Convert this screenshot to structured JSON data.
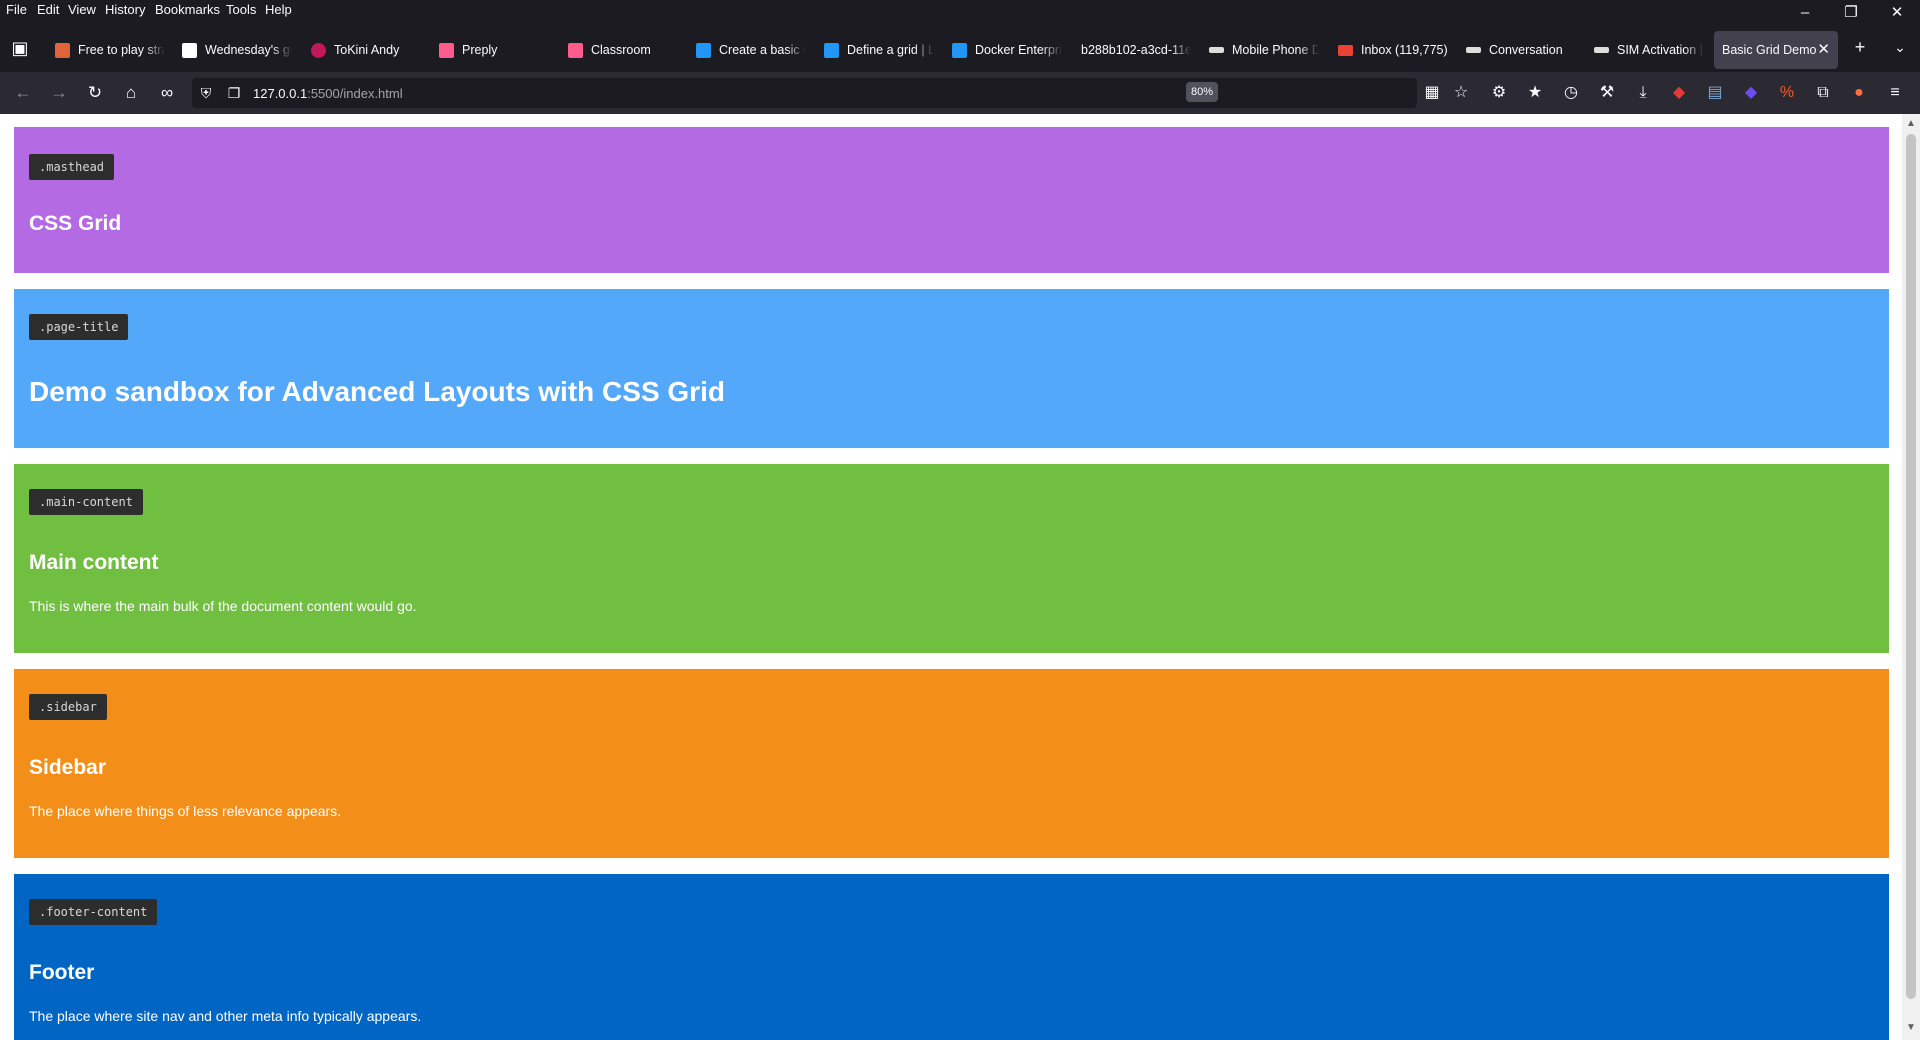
{
  "menubar": {
    "items": [
      "File",
      "Edit",
      "View",
      "History",
      "Bookmarks",
      "Tools",
      "Help"
    ]
  },
  "tabs": [
    {
      "label": "Free to play stra",
      "favicon_color": "#e0643a"
    },
    {
      "label": "Wednesday's gc",
      "favicon_color": "#ffffff"
    },
    {
      "label": "ToKini Andy",
      "favicon_color": "#c2185b"
    },
    {
      "label": "Preply",
      "favicon_color": "#ff5c8d"
    },
    {
      "label": "Classroom",
      "favicon_color": "#ff5c8d"
    },
    {
      "label": "Create a basic G",
      "favicon_color": "#2196f3"
    },
    {
      "label": "Define a grid | L",
      "favicon_color": "#2196f3"
    },
    {
      "label": "Docker Enterpri",
      "favicon_color": "#2196f3"
    },
    {
      "label": "b288b102-a3cd-11e",
      "favicon_color": ""
    },
    {
      "label": "Mobile Phone D",
      "favicon_color": "#dddddd"
    },
    {
      "label": "Inbox (119,775)",
      "favicon_color": "#ea4335"
    },
    {
      "label": "Conversation",
      "favicon_color": "#dddddd"
    },
    {
      "label": "SIM Activation |",
      "favicon_color": "#dddddd"
    }
  ],
  "active_tab": {
    "label": "Basic Grid Demo",
    "close": "✕"
  },
  "urlbar": {
    "host": "127.0.0.1",
    "rest": ":5500/index.html",
    "zoom": "80%"
  },
  "page": {
    "sections": [
      {
        "tag": ".masthead",
        "heading": "CSS Grid",
        "text": "",
        "color": "#b36ae2"
      },
      {
        "tag": ".page-title",
        "heading": "Demo sandbox for Advanced Layouts with CSS Grid",
        "text": "",
        "color": "#53a8fa"
      },
      {
        "tag": ".main-content",
        "heading": "Main content",
        "text": "This is where the main bulk of the document content would go.",
        "color": "#70bf41"
      },
      {
        "tag": ".sidebar",
        "heading": "Sidebar",
        "text": "The place where things of less relevance appears.",
        "color": "#f38f19"
      },
      {
        "tag": ".footer-content",
        "heading": "Footer",
        "text": "The place where site nav and other meta info typically appears.",
        "color": "#0065c3"
      }
    ]
  }
}
